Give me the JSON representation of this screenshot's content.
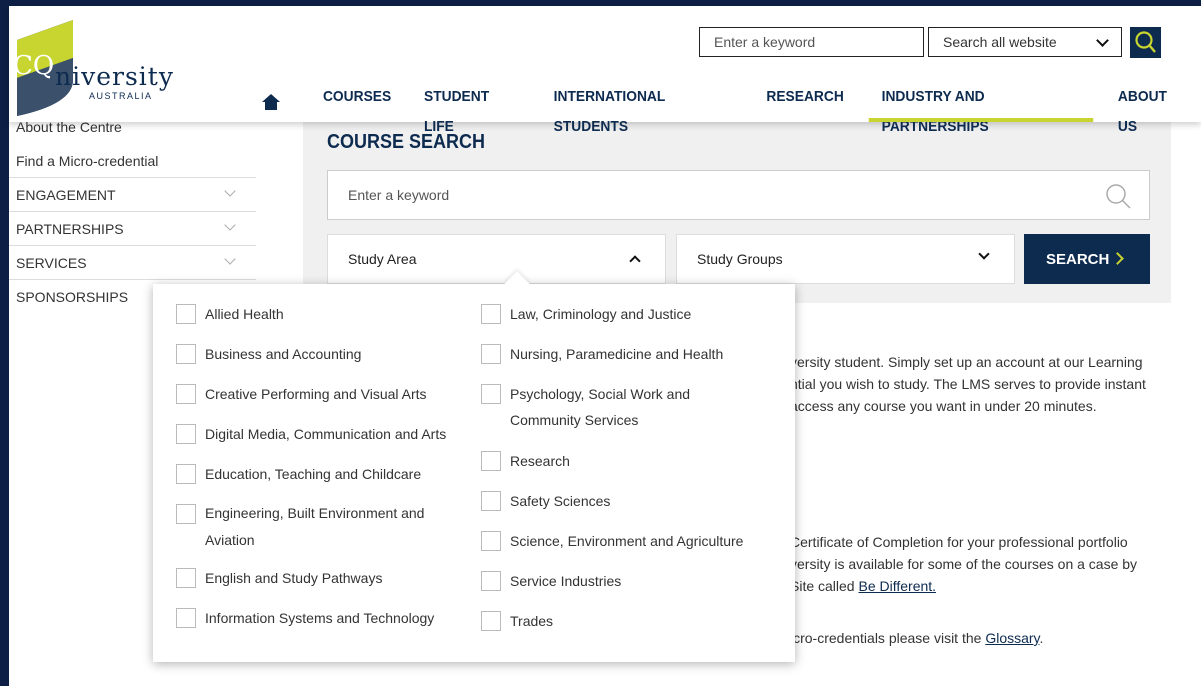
{
  "header": {
    "logo": {
      "main": "CQuniversity",
      "sub": "AUSTRALIA"
    },
    "search_placeholder": "Enter a keyword",
    "scope_label": "Search all website",
    "nav": [
      "COURSES",
      "STUDENT LIFE",
      "INTERNATIONAL STUDENTS",
      "RESEARCH",
      "INDUSTRY AND PARTNERSHIPS",
      "ABOUT US"
    ],
    "active_nav": "INDUSTRY AND PARTNERSHIPS"
  },
  "sidebar": {
    "items": [
      {
        "label": "About the Centre",
        "expandable": false
      },
      {
        "label": "Find a Micro-credential",
        "expandable": false
      },
      {
        "label": "ENGAGEMENT",
        "expandable": true
      },
      {
        "label": "PARTNERSHIPS",
        "expandable": true
      },
      {
        "label": "SERVICES",
        "expandable": true
      },
      {
        "label": "SPONSORSHIPS",
        "expandable": false
      }
    ]
  },
  "course_search": {
    "title": "COURSE SEARCH",
    "keyword_placeholder": "Enter a keyword",
    "study_area_label": "Study Area",
    "study_groups_label": "Study Groups",
    "search_label": "SEARCH"
  },
  "study_area_options": {
    "left": [
      "Allied Health",
      "Business and Accounting",
      "Creative Performing and Visual Arts",
      "Digital Media, Communication and Arts",
      "Education, Teaching and Childcare",
      "Engineering, Built Environment and Aviation",
      "English and Study Pathways",
      "Information Systems and Technology"
    ],
    "right": [
      "Law, Criminology and Justice",
      "Nursing, Paramedicine and Health",
      "Psychology, Social Work and Community Services",
      "Research",
      "Safety Sciences",
      "Science, Environment and Agriculture",
      "Service Industries",
      "Trades"
    ]
  },
  "body": {
    "p1_line1": "versity student. Simply set up an account at our Learning",
    "p1_line2": "ntial you wish to study. The LMS serves to provide instant",
    "p1_line3": "access any course you want in under 20 minutes.",
    "p2_line1": "Certificate of Completion for your professional portfolio",
    "p2_line2": "versity is available for some of the courses on a case by",
    "p2_line3_prefix": "Site called ",
    "p2_link": "Be Different.",
    "p3_prefix": "icro-credentials please visit the ",
    "p3_link": "Glossary",
    "p3_suffix": "."
  },
  "colors": {
    "brand_navy": "#0d2a4f",
    "accent_lime": "#c8d42f"
  }
}
